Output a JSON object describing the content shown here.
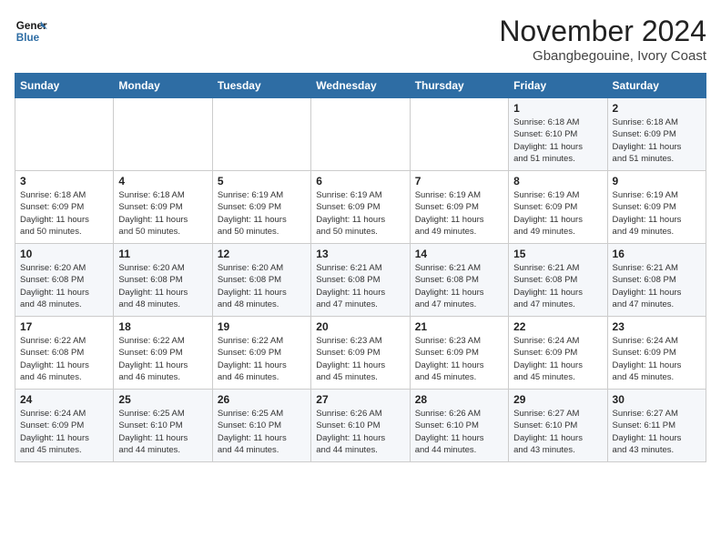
{
  "header": {
    "logo_line1": "General",
    "logo_line2": "Blue",
    "month": "November 2024",
    "location": "Gbangbegouine, Ivory Coast"
  },
  "weekdays": [
    "Sunday",
    "Monday",
    "Tuesday",
    "Wednesday",
    "Thursday",
    "Friday",
    "Saturday"
  ],
  "weeks": [
    [
      {
        "day": "",
        "info": ""
      },
      {
        "day": "",
        "info": ""
      },
      {
        "day": "",
        "info": ""
      },
      {
        "day": "",
        "info": ""
      },
      {
        "day": "",
        "info": ""
      },
      {
        "day": "1",
        "info": "Sunrise: 6:18 AM\nSunset: 6:10 PM\nDaylight: 11 hours\nand 51 minutes."
      },
      {
        "day": "2",
        "info": "Sunrise: 6:18 AM\nSunset: 6:09 PM\nDaylight: 11 hours\nand 51 minutes."
      }
    ],
    [
      {
        "day": "3",
        "info": "Sunrise: 6:18 AM\nSunset: 6:09 PM\nDaylight: 11 hours\nand 50 minutes."
      },
      {
        "day": "4",
        "info": "Sunrise: 6:18 AM\nSunset: 6:09 PM\nDaylight: 11 hours\nand 50 minutes."
      },
      {
        "day": "5",
        "info": "Sunrise: 6:19 AM\nSunset: 6:09 PM\nDaylight: 11 hours\nand 50 minutes."
      },
      {
        "day": "6",
        "info": "Sunrise: 6:19 AM\nSunset: 6:09 PM\nDaylight: 11 hours\nand 50 minutes."
      },
      {
        "day": "7",
        "info": "Sunrise: 6:19 AM\nSunset: 6:09 PM\nDaylight: 11 hours\nand 49 minutes."
      },
      {
        "day": "8",
        "info": "Sunrise: 6:19 AM\nSunset: 6:09 PM\nDaylight: 11 hours\nand 49 minutes."
      },
      {
        "day": "9",
        "info": "Sunrise: 6:19 AM\nSunset: 6:09 PM\nDaylight: 11 hours\nand 49 minutes."
      }
    ],
    [
      {
        "day": "10",
        "info": "Sunrise: 6:20 AM\nSunset: 6:08 PM\nDaylight: 11 hours\nand 48 minutes."
      },
      {
        "day": "11",
        "info": "Sunrise: 6:20 AM\nSunset: 6:08 PM\nDaylight: 11 hours\nand 48 minutes."
      },
      {
        "day": "12",
        "info": "Sunrise: 6:20 AM\nSunset: 6:08 PM\nDaylight: 11 hours\nand 48 minutes."
      },
      {
        "day": "13",
        "info": "Sunrise: 6:21 AM\nSunset: 6:08 PM\nDaylight: 11 hours\nand 47 minutes."
      },
      {
        "day": "14",
        "info": "Sunrise: 6:21 AM\nSunset: 6:08 PM\nDaylight: 11 hours\nand 47 minutes."
      },
      {
        "day": "15",
        "info": "Sunrise: 6:21 AM\nSunset: 6:08 PM\nDaylight: 11 hours\nand 47 minutes."
      },
      {
        "day": "16",
        "info": "Sunrise: 6:21 AM\nSunset: 6:08 PM\nDaylight: 11 hours\nand 47 minutes."
      }
    ],
    [
      {
        "day": "17",
        "info": "Sunrise: 6:22 AM\nSunset: 6:08 PM\nDaylight: 11 hours\nand 46 minutes."
      },
      {
        "day": "18",
        "info": "Sunrise: 6:22 AM\nSunset: 6:09 PM\nDaylight: 11 hours\nand 46 minutes."
      },
      {
        "day": "19",
        "info": "Sunrise: 6:22 AM\nSunset: 6:09 PM\nDaylight: 11 hours\nand 46 minutes."
      },
      {
        "day": "20",
        "info": "Sunrise: 6:23 AM\nSunset: 6:09 PM\nDaylight: 11 hours\nand 45 minutes."
      },
      {
        "day": "21",
        "info": "Sunrise: 6:23 AM\nSunset: 6:09 PM\nDaylight: 11 hours\nand 45 minutes."
      },
      {
        "day": "22",
        "info": "Sunrise: 6:24 AM\nSunset: 6:09 PM\nDaylight: 11 hours\nand 45 minutes."
      },
      {
        "day": "23",
        "info": "Sunrise: 6:24 AM\nSunset: 6:09 PM\nDaylight: 11 hours\nand 45 minutes."
      }
    ],
    [
      {
        "day": "24",
        "info": "Sunrise: 6:24 AM\nSunset: 6:09 PM\nDaylight: 11 hours\nand 45 minutes."
      },
      {
        "day": "25",
        "info": "Sunrise: 6:25 AM\nSunset: 6:10 PM\nDaylight: 11 hours\nand 44 minutes."
      },
      {
        "day": "26",
        "info": "Sunrise: 6:25 AM\nSunset: 6:10 PM\nDaylight: 11 hours\nand 44 minutes."
      },
      {
        "day": "27",
        "info": "Sunrise: 6:26 AM\nSunset: 6:10 PM\nDaylight: 11 hours\nand 44 minutes."
      },
      {
        "day": "28",
        "info": "Sunrise: 6:26 AM\nSunset: 6:10 PM\nDaylight: 11 hours\nand 44 minutes."
      },
      {
        "day": "29",
        "info": "Sunrise: 6:27 AM\nSunset: 6:10 PM\nDaylight: 11 hours\nand 43 minutes."
      },
      {
        "day": "30",
        "info": "Sunrise: 6:27 AM\nSunset: 6:11 PM\nDaylight: 11 hours\nand 43 minutes."
      }
    ]
  ]
}
